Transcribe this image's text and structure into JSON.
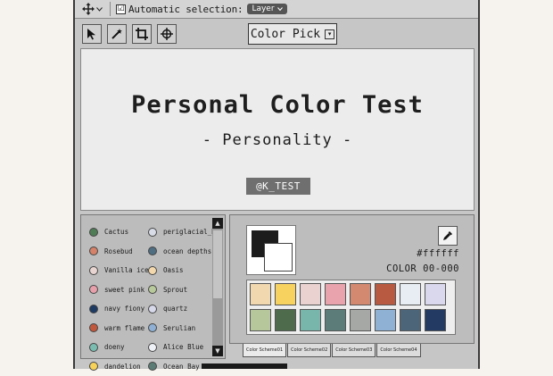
{
  "optbar": {
    "auto_select_checked": "☑",
    "auto_select_label": "Automatic selection:",
    "layer_dropdown": "Layer"
  },
  "toolbar": {
    "color_pick_label": "Color Pick"
  },
  "canvas": {
    "title": "Personal Color Test",
    "subtitle": "- Personality -",
    "badge": "@K_TEST"
  },
  "swatch_list": {
    "left": [
      {
        "name": "Cactus",
        "color": "#4f7b55"
      },
      {
        "name": "Rosebud",
        "color": "#d4826a"
      },
      {
        "name": "Vanilla ice",
        "color": "#e8d4d0"
      },
      {
        "name": "sweet pink",
        "color": "#e6a0ac"
      },
      {
        "name": "navy fiony",
        "color": "#1d3a63"
      },
      {
        "name": "warm flame",
        "color": "#c0583d"
      },
      {
        "name": "doeny",
        "color": "#7bbcb0"
      },
      {
        "name": "dandelion",
        "color": "#f6d25a"
      }
    ],
    "right": [
      {
        "name": "periglacial_B",
        "color": "#d7dce6"
      },
      {
        "name": "ocean depths",
        "color": "#4f6e82"
      },
      {
        "name": "Oasis",
        "color": "#f3d8ad"
      },
      {
        "name": "Sprout",
        "color": "#b8c99c"
      },
      {
        "name": "quartz",
        "color": "#d7d8ea"
      },
      {
        "name": "Serulian",
        "color": "#8fb0d4"
      },
      {
        "name": "Alice Blue",
        "color": "#eef1f6"
      },
      {
        "name": "Ocean Bay",
        "color": "#5b7c75"
      }
    ]
  },
  "scheme": {
    "hex": "#ffffff",
    "color_code": "COLOR 00-000",
    "row1": [
      "#f2d8ae",
      "#f7d25e",
      "#e9d2cf",
      "#e8a3ad",
      "#d3896f",
      "#b85a42",
      "#e8edf4",
      "#d9d8ec"
    ],
    "row2": [
      "#b7c79c",
      "#4e6b4b",
      "#78b6ab",
      "#5c7c7a",
      "#a6a8a6",
      "#8fb1d3",
      "#4c6579",
      "#233a62"
    ],
    "tabs": [
      "Color Scheme01",
      "Color Scheme02",
      "Color Scheme03",
      "Color Scheme04"
    ]
  }
}
